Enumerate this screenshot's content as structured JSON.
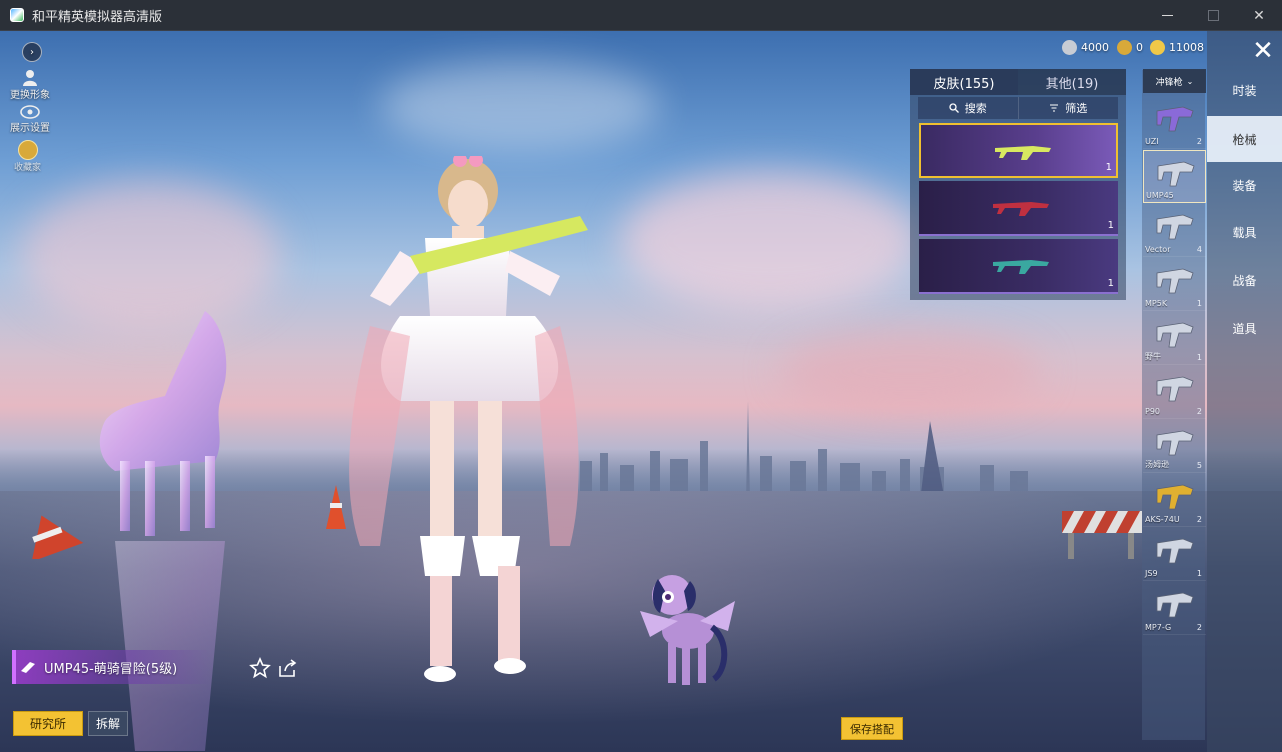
{
  "window": {
    "title": "和平精英模拟器高清版",
    "minimize_label": "",
    "maximize_label": "",
    "close_label": "✕"
  },
  "left_menu": {
    "toggle_label": "›",
    "change_look_label": "更换形象",
    "display_settings_label": "展示设置",
    "collection_label": "收藏家"
  },
  "currency": [
    {
      "name": "silver",
      "value": "4000",
      "color": "#c8ccd4"
    },
    {
      "name": "badge",
      "value": "0",
      "color": "#d8a93a"
    },
    {
      "name": "gold",
      "value": "11008",
      "color": "#f0c848"
    }
  ],
  "skin_panel": {
    "tab_skins": "皮肤(155)",
    "tab_others": "其他(19)",
    "search_label": "搜索",
    "filter_label": "筛选",
    "cards": [
      {
        "qty": "1",
        "color": "#c8e060"
      },
      {
        "qty": "1",
        "color": "#c03040"
      },
      {
        "qty": "1",
        "color": "#3aa8a0"
      }
    ]
  },
  "weapon_list": {
    "dropdown_label": "冲锋枪",
    "items": [
      {
        "name": "UZI",
        "count": "2"
      },
      {
        "name": "UMP45",
        "count": ""
      },
      {
        "name": "Vector",
        "count": "4"
      },
      {
        "name": "MP5K",
        "count": "1"
      },
      {
        "name": "野牛",
        "count": "1"
      },
      {
        "name": "P90",
        "count": "2"
      },
      {
        "name": "汤姆逊",
        "count": "5"
      },
      {
        "name": "AKS-74U",
        "count": "2"
      },
      {
        "name": "JS9",
        "count": "1"
      },
      {
        "name": "MP7-G",
        "count": "2"
      }
    ]
  },
  "categories": {
    "close_label": "✕",
    "items": [
      "时装",
      "枪械",
      "装备",
      "载具",
      "战备",
      "道具"
    ],
    "active": "枪械"
  },
  "bottom": {
    "weapon_name": "UMP45-萌骑冒险(5级)",
    "research_label": "研究所",
    "dismantle_label": "拆解",
    "save_label": "保存搭配"
  },
  "colors": {
    "accent_yellow": "#f3c233",
    "rarity_purple": "#a050e0"
  }
}
